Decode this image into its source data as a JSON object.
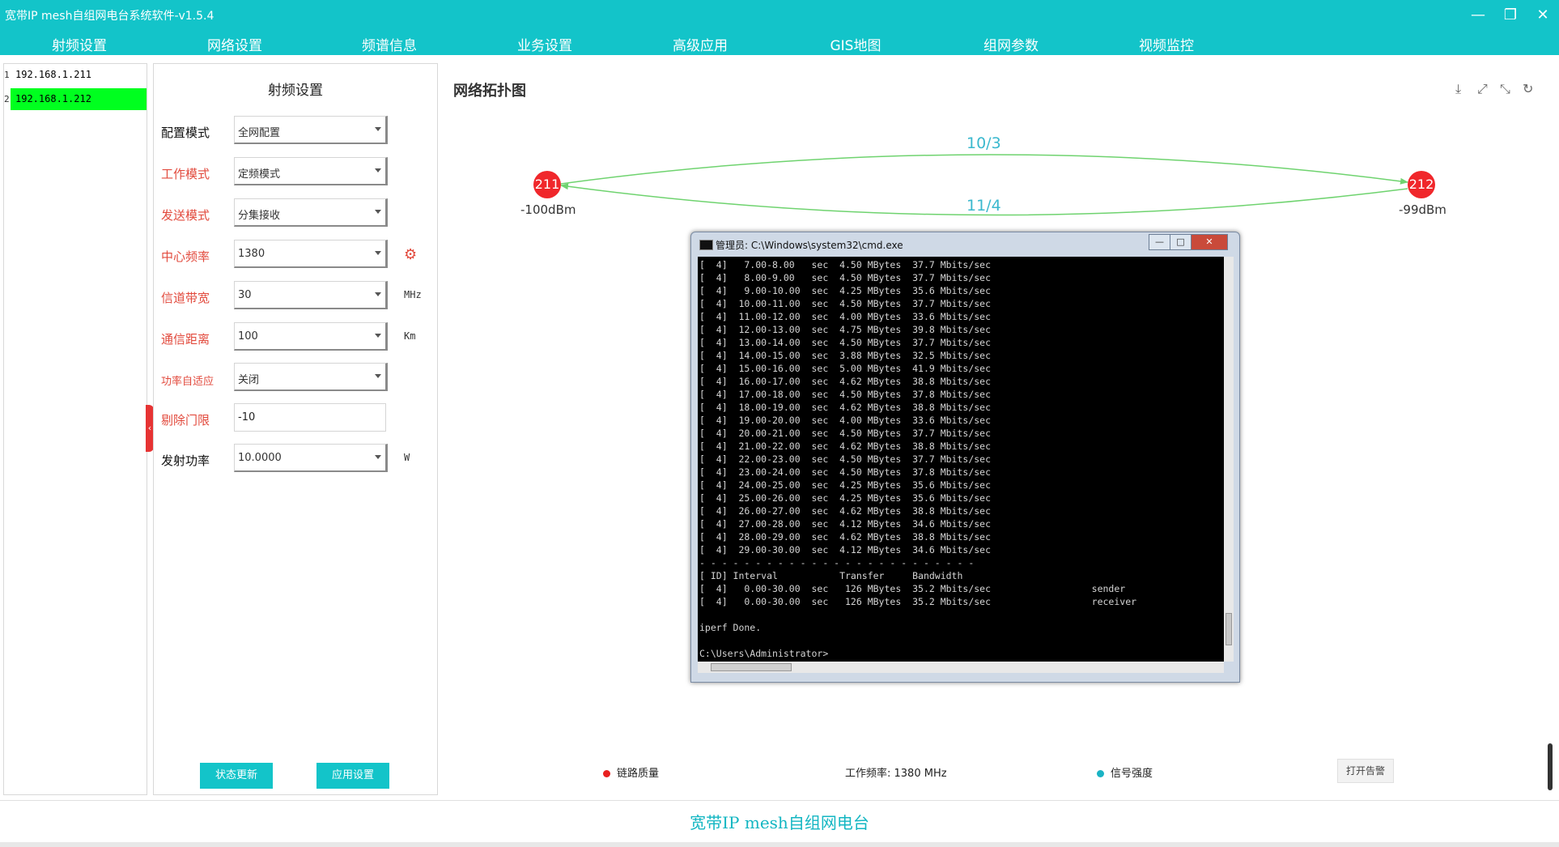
{
  "window": {
    "title": "宽带IP mesh自组网电台系统软件-v1.5.4",
    "minimize": "—",
    "restore": "❐",
    "close": "✕"
  },
  "menu": [
    "射频设置",
    "网络设置",
    "频谱信息",
    "业务设置",
    "高级应用",
    "GIS地图",
    "组网参数",
    "视频监控"
  ],
  "device_list": [
    {
      "index": "1",
      "ip": "192.168.1.211",
      "selected": false
    },
    {
      "index": "2",
      "ip": "192.168.1.212",
      "selected": true
    }
  ],
  "rf_panel": {
    "title": "射频设置",
    "fields": [
      {
        "label": "配置模式",
        "value": "全网配置"
      },
      {
        "label": "工作模式",
        "value": "定频模式"
      },
      {
        "label": "发送模式",
        "value": "分集接收"
      },
      {
        "label": "中心频率",
        "value": "1380"
      },
      {
        "label": "信道带宽",
        "value": "30",
        "unit": "MHz"
      },
      {
        "label": "通信距离",
        "value": "100",
        "unit": "Km"
      },
      {
        "label": "功率自适应",
        "value": "关闭"
      },
      {
        "label": "剔除门限",
        "value": "-10"
      },
      {
        "label": "发射功率",
        "value": "10.0000",
        "unit": "W"
      }
    ],
    "status_button": "状态更新",
    "apply_button": "应用设置",
    "collapse_glyph": "‹"
  },
  "topology": {
    "title": "网络拓扑图",
    "icons": {
      "export": "⤓",
      "fullscreen": "⤢",
      "shrink": "⤡",
      "refresh": "↻"
    },
    "nodes": [
      {
        "id": "211",
        "dbm": "-100dBm"
      },
      {
        "id": "212",
        "dbm": "-99dBm"
      }
    ],
    "links": [
      {
        "label": "10/3"
      },
      {
        "label": "11/4"
      }
    ],
    "colors": {
      "node": "#f0272b",
      "link": "#6fd36f",
      "label": "#3ab8ce"
    }
  },
  "cmd": {
    "title": "管理员: C:\\Windows\\system32\\cmd.exe",
    "btn_min": "—",
    "btn_max": "□",
    "btn_close": "✕",
    "lines": [
      "[  4]   7.00-8.00   sec  4.50 MBytes  37.7 Mbits/sec",
      "[  4]   8.00-9.00   sec  4.50 MBytes  37.7 Mbits/sec",
      "[  4]   9.00-10.00  sec  4.25 MBytes  35.6 Mbits/sec",
      "[  4]  10.00-11.00  sec  4.50 MBytes  37.7 Mbits/sec",
      "[  4]  11.00-12.00  sec  4.00 MBytes  33.6 Mbits/sec",
      "[  4]  12.00-13.00  sec  4.75 MBytes  39.8 Mbits/sec",
      "[  4]  13.00-14.00  sec  4.50 MBytes  37.7 Mbits/sec",
      "[  4]  14.00-15.00  sec  3.88 MBytes  32.5 Mbits/sec",
      "[  4]  15.00-16.00  sec  5.00 MBytes  41.9 Mbits/sec",
      "[  4]  16.00-17.00  sec  4.62 MBytes  38.8 Mbits/sec",
      "[  4]  17.00-18.00  sec  4.50 MBytes  37.8 Mbits/sec",
      "[  4]  18.00-19.00  sec  4.62 MBytes  38.8 Mbits/sec",
      "[  4]  19.00-20.00  sec  4.00 MBytes  33.6 Mbits/sec",
      "[  4]  20.00-21.00  sec  4.50 MBytes  37.7 Mbits/sec",
      "[  4]  21.00-22.00  sec  4.62 MBytes  38.8 Mbits/sec",
      "[  4]  22.00-23.00  sec  4.50 MBytes  37.7 Mbits/sec",
      "[  4]  23.00-24.00  sec  4.50 MBytes  37.8 Mbits/sec",
      "[  4]  24.00-25.00  sec  4.25 MBytes  35.6 Mbits/sec",
      "[  4]  25.00-26.00  sec  4.25 MBytes  35.6 Mbits/sec",
      "[  4]  26.00-27.00  sec  4.62 MBytes  38.8 Mbits/sec",
      "[  4]  27.00-28.00  sec  4.12 MBytes  34.6 Mbits/sec",
      "[  4]  28.00-29.00  sec  4.62 MBytes  38.8 Mbits/sec",
      "[  4]  29.00-30.00  sec  4.12 MBytes  34.6 Mbits/sec",
      "- - - - - - - - - - - - - - - - - - - - - - - - -",
      "[ ID] Interval           Transfer     Bandwidth",
      "[  4]   0.00-30.00  sec   126 MBytes  35.2 Mbits/sec                  sender",
      "[  4]   0.00-30.00  sec   126 MBytes  35.2 Mbits/sec                  receiver",
      "",
      "iperf Done.",
      "",
      "C:\\Users\\Administrator>"
    ]
  },
  "status_bar": {
    "link_quality": "链路质量",
    "link_quality_color": "#e8201f",
    "work_freq": "工作频率: 1380 MHz",
    "signal_strength": "信号强度",
    "signal_strength_color": "#1ab3c4",
    "alarm_button": "打开告警"
  },
  "footer": {
    "text": "宽带IP mesh自组网电台"
  }
}
